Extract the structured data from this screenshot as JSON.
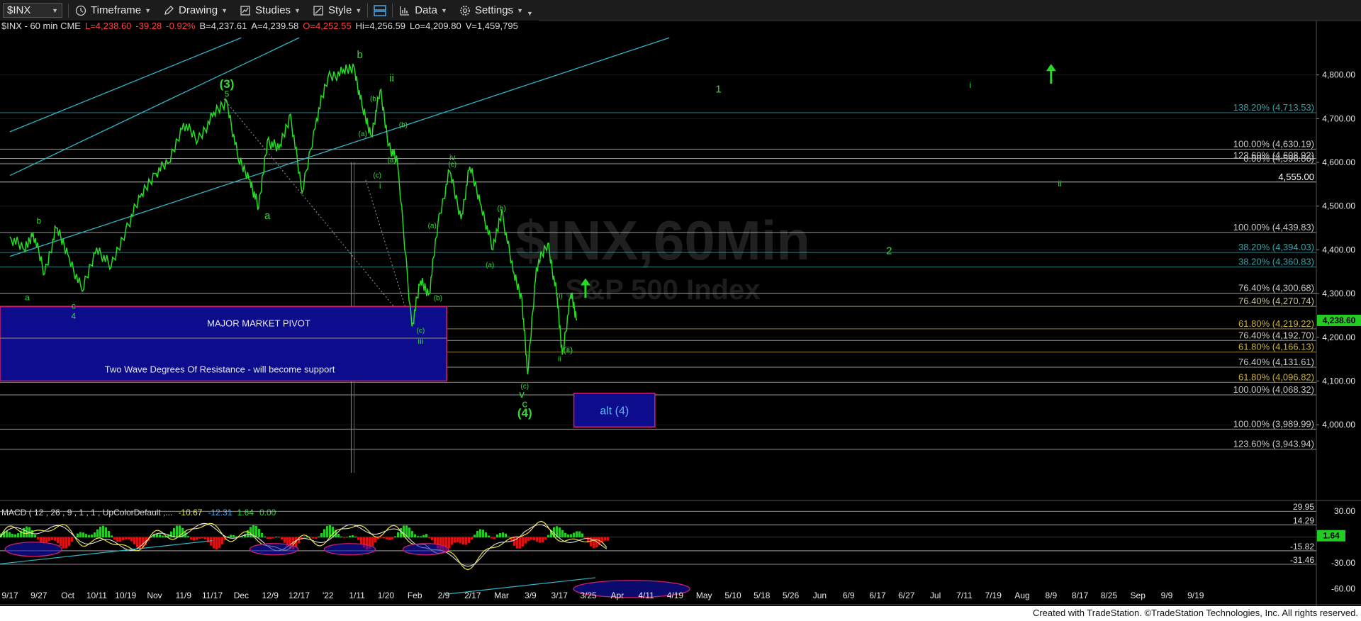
{
  "toolbar": {
    "symbol": "$INX",
    "items": [
      "Timeframe",
      "Drawing",
      "Studies",
      "Style",
      "Data",
      "Settings"
    ]
  },
  "colors": {
    "background": "#000000",
    "price": "#22dd22",
    "channel": "#2fb4c8",
    "pivot_box": "#0c0c8c",
    "pivot_border": "#d0206c",
    "wave_label": "#38d838",
    "fib_text": "#c8c8c8"
  },
  "header": {
    "symbol": "$INX - 60 min",
    "exchange": "CME",
    "last": "L=4,238.60",
    "change": "-39.28",
    "change_pct": "-0.92%",
    "bid": "B=4,237.61",
    "ask": "A=4,239.58",
    "open": "O=4,252.55",
    "high": "Hi=4,256.59",
    "low": "Lo=4,209.80",
    "volume": "V=1,459,795"
  },
  "chart_data": [
    {
      "type": "line",
      "title": "$INX - 60 min",
      "xlabel": "",
      "ylabel": "",
      "ylim": [
        3830,
        4900
      ],
      "x": [
        "9/17",
        "9/27",
        "Oct",
        "10/11",
        "10/19",
        "Nov",
        "11/9",
        "11/17",
        "Dec",
        "12/9",
        "12/17",
        "'22",
        "1/11",
        "1/20",
        "Feb",
        "2/9",
        "2/17",
        "Mar",
        "3/9",
        "3/17",
        "3/25",
        "Apr",
        "4/11",
        "4/19",
        "May",
        "5/10",
        "5/18",
        "5/26",
        "Jun",
        "6/9",
        "6/17",
        "6/27",
        "Jul",
        "7/11",
        "7/19",
        "Aug",
        "8/9",
        "8/17",
        "8/25",
        "Sep",
        "9/9",
        "9/19"
      ],
      "yticks": [
        4000,
        4100,
        4200,
        4300,
        4400,
        4500,
        4600,
        4700,
        4800
      ],
      "ytick_labels": [
        "4,000.00",
        "4,100.00",
        "4,200.00",
        "4,300.00",
        "4,400.00",
        "4,500.00",
        "4,600.00",
        "4,700.00",
        "4,800.00"
      ],
      "series": [
        {
          "values": [
            {
              "x": 0.0,
              "y": 4430
            },
            {
              "x": 0.5,
              "y": 4400
            },
            {
              "x": 0.8,
              "y": 4440
            },
            {
              "x": 1.2,
              "y": 4345
            },
            {
              "x": 1.6,
              "y": 4450
            },
            {
              "x": 2.0,
              "y": 4390
            },
            {
              "x": 2.5,
              "y": 4305
            },
            {
              "x": 3.0,
              "y": 4405
            },
            {
              "x": 3.5,
              "y": 4360
            },
            {
              "x": 4.0,
              "y": 4445
            },
            {
              "x": 4.5,
              "y": 4520
            },
            {
              "x": 5.0,
              "y": 4575
            },
            {
              "x": 5.5,
              "y": 4600
            },
            {
              "x": 6.0,
              "y": 4690
            },
            {
              "x": 6.5,
              "y": 4650
            },
            {
              "x": 7.0,
              "y": 4705
            },
            {
              "x": 7.5,
              "y": 4740
            },
            {
              "x": 7.9,
              "y": 4605
            },
            {
              "x": 8.3,
              "y": 4560
            },
            {
              "x": 8.6,
              "y": 4495
            },
            {
              "x": 8.9,
              "y": 4650
            },
            {
              "x": 9.3,
              "y": 4630
            },
            {
              "x": 9.7,
              "y": 4710
            },
            {
              "x": 10.1,
              "y": 4530
            },
            {
              "x": 10.6,
              "y": 4700
            },
            {
              "x": 11.0,
              "y": 4795
            },
            {
              "x": 11.5,
              "y": 4805
            },
            {
              "x": 11.9,
              "y": 4818
            },
            {
              "x": 12.2,
              "y": 4720
            },
            {
              "x": 12.5,
              "y": 4660
            },
            {
              "x": 12.8,
              "y": 4765
            },
            {
              "x": 13.1,
              "y": 4640
            },
            {
              "x": 13.4,
              "y": 4600
            },
            {
              "x": 13.9,
              "y": 4225
            },
            {
              "x": 14.2,
              "y": 4330
            },
            {
              "x": 14.5,
              "y": 4300
            },
            {
              "x": 14.8,
              "y": 4460
            },
            {
              "x": 15.2,
              "y": 4580
            },
            {
              "x": 15.6,
              "y": 4470
            },
            {
              "x": 15.9,
              "y": 4590
            },
            {
              "x": 16.3,
              "y": 4500
            },
            {
              "x": 16.7,
              "y": 4400
            },
            {
              "x": 17.0,
              "y": 4490
            },
            {
              "x": 17.4,
              "y": 4350
            },
            {
              "x": 17.7,
              "y": 4290
            },
            {
              "x": 17.9,
              "y": 4115
            },
            {
              "x": 18.2,
              "y": 4360
            },
            {
              "x": 18.6,
              "y": 4415
            },
            {
              "x": 18.9,
              "y": 4300
            },
            {
              "x": 19.1,
              "y": 4160
            },
            {
              "x": 19.4,
              "y": 4300
            },
            {
              "x": 19.6,
              "y": 4238.6
            }
          ]
        }
      ],
      "wave_labels": [
        {
          "text": "(3)",
          "x": 7.5,
          "y": 4770,
          "size": "large"
        },
        {
          "text": "5",
          "x": 7.5,
          "y": 4750,
          "size": "small"
        },
        {
          "text": "b",
          "x": 12.1,
          "y": 4838,
          "size": "medium"
        },
        {
          "text": "ii",
          "x": 13.2,
          "y": 4785,
          "size": "medium"
        },
        {
          "text": "iv",
          "x": 15.3,
          "y": 4605,
          "size": "small"
        },
        {
          "text": "(b)",
          "x": 12.6,
          "y": 4740,
          "size": "tiny"
        },
        {
          "text": "(b)",
          "x": 13.6,
          "y": 4680,
          "size": "tiny"
        },
        {
          "text": "(a)",
          "x": 12.2,
          "y": 4660,
          "size": "tiny"
        },
        {
          "text": "(a)",
          "x": 13.2,
          "y": 4600,
          "size": "tiny"
        },
        {
          "text": "(c)",
          "x": 12.7,
          "y": 4565,
          "size": "tiny"
        },
        {
          "text": "(c)",
          "x": 15.3,
          "y": 4590,
          "size": "tiny"
        },
        {
          "text": "i",
          "x": 12.8,
          "y": 4540,
          "size": "small"
        },
        {
          "text": "a",
          "x": 8.9,
          "y": 4470,
          "size": "medium"
        },
        {
          "text": "b",
          "x": 1.0,
          "y": 4460,
          "size": "small"
        },
        {
          "text": "a",
          "x": 0.6,
          "y": 4285,
          "size": "small"
        },
        {
          "text": "c",
          "x": 2.2,
          "y": 4265,
          "size": "small"
        },
        {
          "text": "4",
          "x": 2.2,
          "y": 4242,
          "size": "small"
        },
        {
          "text": "(b)",
          "x": 17.0,
          "y": 4490,
          "size": "tiny"
        },
        {
          "text": "(a)",
          "x": 14.6,
          "y": 4450,
          "size": "tiny"
        },
        {
          "text": "(a)",
          "x": 16.6,
          "y": 4360,
          "size": "tiny"
        },
        {
          "text": "(b)",
          "x": 14.8,
          "y": 4285,
          "size": "tiny"
        },
        {
          "text": "(c)",
          "x": 14.2,
          "y": 4210,
          "size": "tiny"
        },
        {
          "text": "iii",
          "x": 14.2,
          "y": 4185,
          "size": "small"
        },
        {
          "text": "(i)",
          "x": 19.0,
          "y": 4290,
          "size": "tiny"
        },
        {
          "text": "(ii)",
          "x": 19.3,
          "y": 4165,
          "size": "small"
        },
        {
          "text": "ii",
          "x": 19.0,
          "y": 4145,
          "size": "tiny"
        },
        {
          "text": "(c)",
          "x": 17.8,
          "y": 4083,
          "size": "tiny"
        },
        {
          "text": "v",
          "x": 17.7,
          "y": 4062,
          "size": "medium"
        },
        {
          "text": "c",
          "x": 17.8,
          "y": 4040,
          "size": "medium"
        },
        {
          "text": "(4)",
          "x": 17.8,
          "y": 4018,
          "size": "large"
        },
        {
          "text": "1",
          "x": 24.5,
          "y": 4760,
          "size": "medium"
        },
        {
          "text": "i",
          "x": 33.2,
          "y": 4770,
          "size": "small"
        },
        {
          "text": "ii",
          "x": 36.3,
          "y": 4545,
          "size": "small"
        },
        {
          "text": "2",
          "x": 30.4,
          "y": 4390,
          "size": "medium"
        }
      ],
      "arrows": [
        {
          "x": 19.9,
          "y_from": 4290,
          "y_to": 4335
        },
        {
          "x": 36.0,
          "y_from": 4780,
          "y_to": 4825
        }
      ],
      "fib_levels": [
        {
          "label": "138.20% (4,713.53)",
          "value": 4713.53,
          "color": "#3aa0a8"
        },
        {
          "label": "100.00% (4,630.19)",
          "value": 4630.19,
          "color": "#c8c8c8"
        },
        {
          "label": "123.60% (4,608.92)",
          "value": 4608.92,
          "color": "#c8c8c8"
        },
        {
          "label": "0.00% (4,596.86)",
          "value": 4596.86,
          "color": "#c8c8c8"
        },
        {
          "label": "4,555.00",
          "value": 4555.0,
          "color": "#ffffff"
        },
        {
          "label": "100.00% (4,439.83)",
          "value": 4439.83,
          "color": "#c8c8c8"
        },
        {
          "label": "38.20% (4,394.03)",
          "value": 4394.03,
          "color": "#3aa0a8"
        },
        {
          "label": "38.20% (4,360.83)",
          "value": 4360.83,
          "color": "#3aa0a8"
        },
        {
          "label": "76.40% (4,300.68)",
          "value": 4300.68,
          "color": "#c8c8c8"
        },
        {
          "label": "76.40% (4,270.74)",
          "value": 4270.74,
          "color": "#c8c0a0"
        },
        {
          "label": "61.80% (4,219.22)",
          "value": 4219.22,
          "color": "#c8b040"
        },
        {
          "label": "76.40% (4,192.70)",
          "value": 4192.7,
          "color": "#c8c8c8"
        },
        {
          "label": "61.80% (4,166.13)",
          "value": 4166.13,
          "color": "#c8b040"
        },
        {
          "label": "76.40% (4,131.61)",
          "value": 4131.61,
          "color": "#c8c8c8"
        },
        {
          "label": "61.80% (4,096.82)",
          "value": 4096.82,
          "color": "#c8b040"
        },
        {
          "label": "100.00% (4,068.32)",
          "value": 4068.32,
          "color": "#c8c8c8"
        },
        {
          "label": "100.00% (3,989.99)",
          "value": 3989.99,
          "color": "#c8c8c8"
        },
        {
          "label": "123.60% (3,943.94)",
          "value": 3943.94,
          "color": "#c8c8c8"
        }
      ],
      "pivot_box": {
        "label": "MAJOR MARKET PIVOT",
        "sublabel": "Two Wave Degrees Of Resistance - will become support",
        "y_top": 4270,
        "y_bottom": 4100,
        "x_end": 15.1
      },
      "alt_box": {
        "label": "alt (4)",
        "y_top": 4072,
        "y_bottom": 3995,
        "x_start": 19.5,
        "x_end": 22.3
      },
      "last_price": "4,238.60",
      "watermark": {
        "title": "$INX,60Min",
        "subtitle": "S&P 500 Index"
      }
    },
    {
      "type": "line",
      "title": "MACD ( 12 , 26 , 9 , 1 , 1 , UpColorDefault ,...",
      "values_text": [
        "-10.67",
        "-12.31",
        "1.64",
        "0.00"
      ],
      "value_colors": [
        "#e8e840",
        "#4aa8e8",
        "#30d830",
        "#30d830"
      ],
      "ylim": [
        -75,
        40
      ],
      "yticks": [
        30,
        0,
        -30,
        -60
      ],
      "ytick_labels": [
        "30.00",
        "0.00",
        "-30.00",
        "-60.00"
      ],
      "levels": [
        {
          "label": "29.95",
          "value": 29.95
        },
        {
          "label": "14.29",
          "value": 14.29
        },
        {
          "label": "-15.82",
          "value": -15.82
        },
        {
          "label": "-31.46",
          "value": -31.46
        }
      ],
      "histogram_last": "1.64"
    }
  ],
  "footer": {
    "credit": "Created with TradeStation. ©TradeStation Technologies, Inc. All rights reserved."
  }
}
